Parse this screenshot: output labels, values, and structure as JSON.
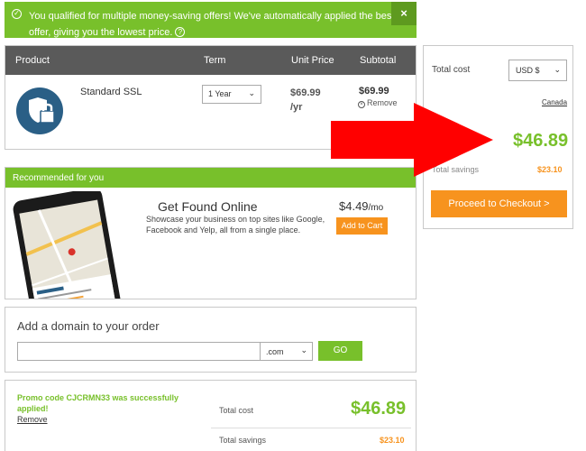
{
  "banner": {
    "message": "You qualified for multiple money-saving offers! We've automatically applied the best offer, giving you the lowest price.",
    "help_icon": "?",
    "close": "×",
    "check": "✓"
  },
  "cart": {
    "headers": {
      "product": "Product",
      "term": "Term",
      "unit_price": "Unit Price",
      "subtotal": "Subtotal"
    },
    "item": {
      "name": "Standard SSL",
      "term": "1 Year",
      "unit_price": "$69.99",
      "unit_suffix": "/yr",
      "subtotal": "$69.99",
      "remove": "Remove",
      "icon": "ssl-shield-lock-icon"
    }
  },
  "recommended": {
    "header": "Recommended for you",
    "title": "Get Found Online",
    "description": "Showcase your business on top sites like Google, Facebook and Yelp, all from a single place.",
    "price": "$4.49",
    "price_suffix": "/mo",
    "add_button": "Add to Cart"
  },
  "domain": {
    "title": "Add a domain to your order",
    "input_value": "",
    "tld": ".com",
    "go_button": "GO"
  },
  "promo": {
    "message": "Promo code CJCRMN33 was successfully applied!",
    "remove": "Remove",
    "total_cost_label": "Total cost",
    "total_cost": "$46.89",
    "total_savings_label": "Total savings",
    "total_savings": "$23.10"
  },
  "summary": {
    "total_cost_label": "Total cost",
    "currency": "USD $",
    "country": "Canada",
    "total": "$46.89",
    "total_savings_label": "Total savings",
    "total_savings": "$23.10",
    "checkout_button": "Proceed to Checkout >"
  },
  "colors": {
    "green": "#78c02b",
    "orange": "#f7931e",
    "header_gray": "#5a5a5a",
    "arrow_red": "#ff0000",
    "shield_blue": "#2a5f86"
  }
}
